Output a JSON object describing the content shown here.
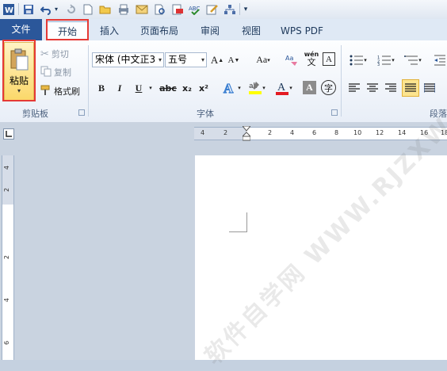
{
  "tabs": {
    "file": "文件",
    "home": "开始",
    "insert": "插入",
    "layout": "页面布局",
    "review": "审阅",
    "view": "视图",
    "wps_pdf": "WPS PDF"
  },
  "clipboard": {
    "paste": "粘贴",
    "cut": "剪切",
    "copy": "复制",
    "format_painter": "格式刷",
    "group_label": "剪贴板"
  },
  "font": {
    "font_name": "宋体 (中文正3",
    "font_size": "五号",
    "group_label": "字体",
    "bold": "B",
    "italic": "I",
    "underline": "U",
    "strike": "abc",
    "subscript": "x₂",
    "superscript": "x²",
    "grow": "A",
    "shrink": "A",
    "change_case": "Aa",
    "phonetic": "wén",
    "border_char": "A",
    "shade_char": "A",
    "enclose_char": "字"
  },
  "paragraph": {
    "group_label": "段落"
  },
  "ruler": {
    "h_ticks": [
      "4",
      "2",
      "2",
      "4",
      "6",
      "8",
      "10",
      "12",
      "14",
      "16",
      "18"
    ],
    "v_ticks": [
      "4",
      "2",
      "2",
      "4",
      "6"
    ]
  },
  "watermark": "软件自学网 WWW.RJZXW.COM",
  "colors": {
    "file_tab": "#2b579a",
    "highlight_box": "#e53935",
    "selected_button": "#fce48f"
  }
}
